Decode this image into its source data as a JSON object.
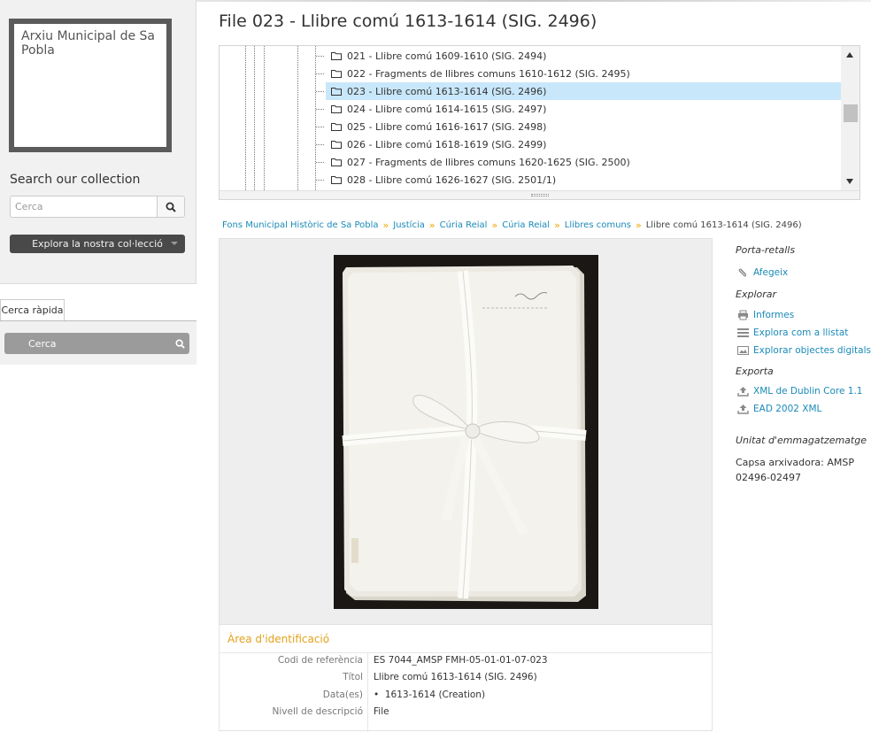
{
  "sidebar": {
    "logo_text": "Arxiu Municipal de Sa Pobla",
    "search_title": "Search our collection",
    "search_placeholder": "Cerca",
    "browse_label": "Explora la nostra col·lecció",
    "quick_tab_label": "Cerca ràpida",
    "quick_search_label": "Cerca"
  },
  "page": {
    "title": "File 023 - Llibre comú 1613-1614 (SIG. 2496)"
  },
  "tree": {
    "items": [
      {
        "label": "021 - Llibre comú 1609-1610 (SIG. 2494)",
        "selected": false
      },
      {
        "label": "022 - Fragments de llibres comuns 1610-1612 (SIG. 2495)",
        "selected": false
      },
      {
        "label": "023 - Llibre comú 1613-1614 (SIG. 2496)",
        "selected": true
      },
      {
        "label": "024 - Llibre comú 1614-1615 (SIG. 2497)",
        "selected": false
      },
      {
        "label": "025 - Llibre comú 1616-1617 (SIG. 2498)",
        "selected": false
      },
      {
        "label": "026 - Llibre comú 1618-1619 (SIG. 2499)",
        "selected": false
      },
      {
        "label": "027 - Fragments de llibres comuns 1620-1625 (SIG. 2500)",
        "selected": false
      },
      {
        "label": "028 - Llibre comú 1626-1627 (SIG. 2501/1)",
        "selected": false
      }
    ]
  },
  "breadcrumb": {
    "links": [
      "Fons Municipal Històric de Sa Pobla",
      "Justícia",
      "Cúria Reial",
      "Cúria Reial",
      "Llibres comuns"
    ],
    "current": "Llibre comú 1613-1614 (SIG. 2496)"
  },
  "identification": {
    "title": "Àrea d'identificació",
    "fields": [
      {
        "label": "Codi de referència",
        "value": "ES 7044_AMSP FMH-05-01-01-07-023"
      },
      {
        "label": "Títol",
        "value": "Llibre comú 1613-1614 (SIG. 2496)"
      },
      {
        "label": "Data(es)",
        "value": "1613-1614 (Creation)"
      },
      {
        "label": "Nivell de descripció",
        "value": "File"
      }
    ]
  },
  "context_menu": {
    "clipboard_heading": "Porta-retalls",
    "clipboard_add": "Afegeix",
    "explore_heading": "Explorar",
    "reports": "Informes",
    "browse_list": "Explora com a llistat",
    "browse_digital": "Explorar objectes digitals",
    "export_heading": "Exporta",
    "export_dc": "XML de Dublin Core 1.1",
    "export_ead": "EAD 2002 XML",
    "storage_heading": "Unitat d'emmagatzematge",
    "storage_value": "Capsa arxivadora: AMSP 02496-02497"
  },
  "icons": {
    "search": "search-icon",
    "folder": "folder-icon",
    "paperclip": "paperclip-icon",
    "print": "print-icon",
    "list": "list-icon",
    "image": "image-icon",
    "upload": "upload-icon"
  },
  "colors": {
    "link": "#1a8ab8",
    "section_title": "#e3a21a",
    "selected_row": "#c9e7fa",
    "breadcrumb_sep": "#f0a500"
  }
}
